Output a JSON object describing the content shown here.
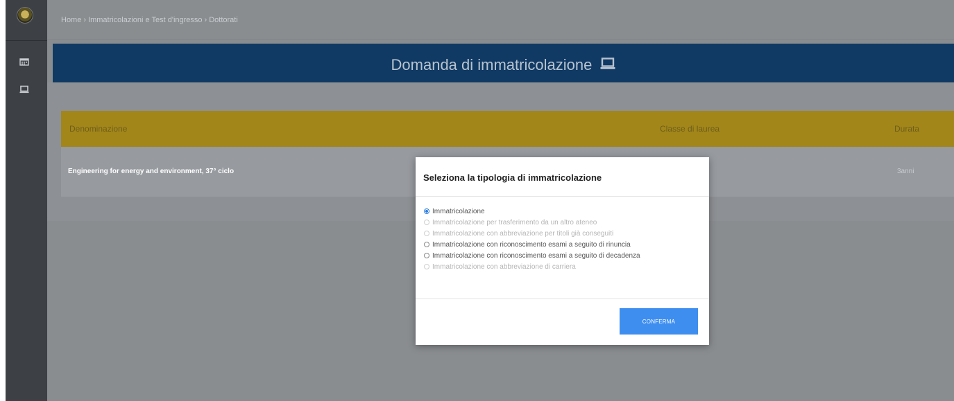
{
  "breadcrumb": {
    "items": [
      "Home",
      "Immatricolazioni e Test d'ingresso",
      "Dottorati"
    ],
    "separator": "›"
  },
  "sidebar": {
    "logo": "university-seal",
    "items": [
      {
        "icon": "calendar-icon"
      },
      {
        "icon": "laptop-icon"
      }
    ]
  },
  "header": {
    "title": "Domanda di immatricolazione",
    "icon": "laptop-icon"
  },
  "table": {
    "columns": [
      "Denominazione",
      "Classe di laurea",
      "Durata"
    ],
    "rows": [
      {
        "denominazione": "Engineering for energy and environment, 37° ciclo",
        "classe": "",
        "durata": "3anni"
      }
    ]
  },
  "modal": {
    "title": "Seleziona la tipologia di immatricolazione",
    "options": [
      {
        "label": "Immatricolazione",
        "selected": true,
        "disabled": false
      },
      {
        "label": "Immatricolazione per trasferimento da un altro ateneo",
        "selected": false,
        "disabled": true
      },
      {
        "label": "Immatricolazione con abbreviazione per titoli già conseguiti",
        "selected": false,
        "disabled": true
      },
      {
        "label": "Immatricolazione con riconoscimento esami a seguito di rinuncia",
        "selected": false,
        "disabled": false
      },
      {
        "label": "Immatricolazione con riconoscimento esami a seguito di decadenza",
        "selected": false,
        "disabled": false
      },
      {
        "label": "Immatricolazione con abbreviazione di carriera",
        "selected": false,
        "disabled": true
      }
    ],
    "confirm_label": "CONFERMA"
  },
  "colors": {
    "header_bg": "#103a64",
    "table_header_bg": "#a2861a",
    "sidebar_bg": "#3d4146",
    "overlay": "#8a8d90",
    "button_bg": "#3e8ef0",
    "radio_selected": "#2a7de1"
  }
}
